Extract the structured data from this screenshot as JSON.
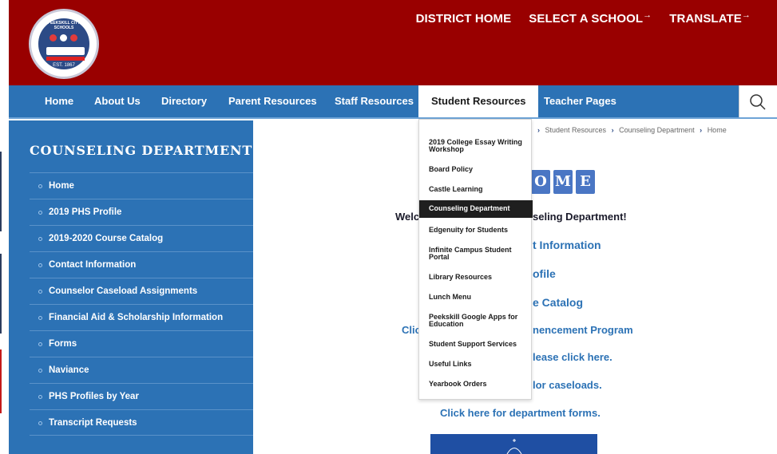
{
  "header": {
    "logo_text": "PEEKSKILL CITY SCHOOLS",
    "logo_est": "EST. 1867",
    "top_links": [
      {
        "label": "DISTRICT HOME",
        "arrow": ""
      },
      {
        "label": "SELECT A SCHOOL",
        "arrow": "→"
      },
      {
        "label": "TRANSLATE",
        "arrow": "→"
      }
    ]
  },
  "nav": {
    "items": [
      "Home",
      "About Us",
      "Directory",
      "Parent Resources",
      "Staff Resources",
      "Student Resources",
      "Teacher Pages"
    ],
    "active": "Student Resources",
    "search_icon": "search-icon"
  },
  "sidebar": {
    "title": "COUNSELING DEPARTMENT",
    "items": [
      "Home",
      "2019 PHS Profile",
      "2019-2020 Course Catalog",
      "Contact Information",
      "Counselor Caseload Assignments",
      "Financial Aid & Scholarship Information",
      "Forms",
      "Naviance",
      "PHS Profiles by Year",
      "Transcript Requests"
    ]
  },
  "breadcrumb": [
    "Student Resources",
    "Counseling Department",
    "Home"
  ],
  "main": {
    "home_letters": [
      "O",
      "M",
      "E"
    ],
    "welcome_left": "Welc",
    "welcome_right": "seling Department!",
    "contact": "t Information",
    "profile": "ofile",
    "catalog": "e Catalog",
    "commencement_left": "Clic",
    "commencement_right": "nencement Program",
    "please": "lease click here.",
    "caseloads": "lor caseloads.",
    "forms_link": "Click here for department forms."
  },
  "dropdown": {
    "items": [
      "2019 College Essay Writing Workshop",
      "Board Policy",
      "Castle Learning",
      "Counseling Department",
      "Edgenuity for Students",
      "Infinite Campus Student Portal",
      "Library Resources",
      "Lunch Menu",
      "Peekskill Google Apps for Education",
      "Student Support Services",
      "Useful Links",
      "Yearbook Orders"
    ],
    "active": "Counseling Department"
  },
  "colors": {
    "header_red": "#990000",
    "nav_blue": "#2c72b5",
    "link_blue": "#2c72b5"
  }
}
